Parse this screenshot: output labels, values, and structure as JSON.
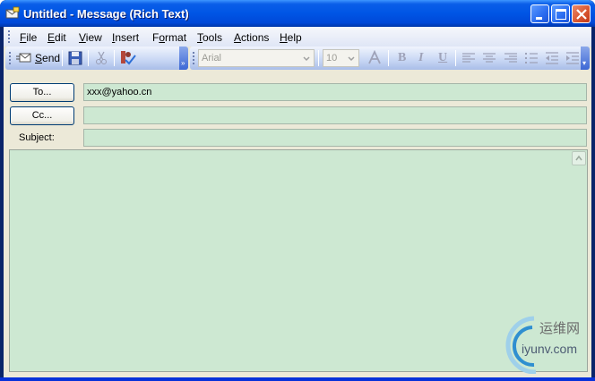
{
  "window": {
    "title": "Untitled - Message (Rich Text)",
    "icon": "envelope-icon"
  },
  "menu": {
    "items": [
      {
        "label": "File",
        "mnemonic": "F",
        "rest": "ile"
      },
      {
        "label": "Edit",
        "mnemonic": "E",
        "rest": "dit"
      },
      {
        "label": "View",
        "mnemonic": "V",
        "rest": "iew"
      },
      {
        "label": "Insert",
        "mnemonic": "I",
        "rest": "nsert"
      },
      {
        "label": "Format",
        "pre": "F",
        "mnemonic": "o",
        "rest": "rmat"
      },
      {
        "label": "Tools",
        "mnemonic": "T",
        "rest": "ools"
      },
      {
        "label": "Actions",
        "mnemonic": "A",
        "rest": "ctions"
      },
      {
        "label": "Help",
        "mnemonic": "H",
        "rest": "elp"
      }
    ]
  },
  "toolbar": {
    "send_label": "Send",
    "send_mnemonic": "S",
    "send_rest": "end",
    "font_name": "Arial",
    "font_size": "10",
    "bold": "B",
    "italic": "I",
    "underline": "U"
  },
  "header": {
    "to_button": "To...",
    "to_value": "xxx@yahoo.cn",
    "cc_button": "Cc...",
    "cc_value": "",
    "subject_label": "Subject:",
    "subject_value": ""
  },
  "body": {
    "text": ""
  },
  "watermark": {
    "chinese": "运维网",
    "site": "iyunv.com"
  },
  "colors": {
    "title_bar": "#0055e5",
    "field_background": "#cde8d2",
    "dialog_face": "#ece9d8"
  }
}
